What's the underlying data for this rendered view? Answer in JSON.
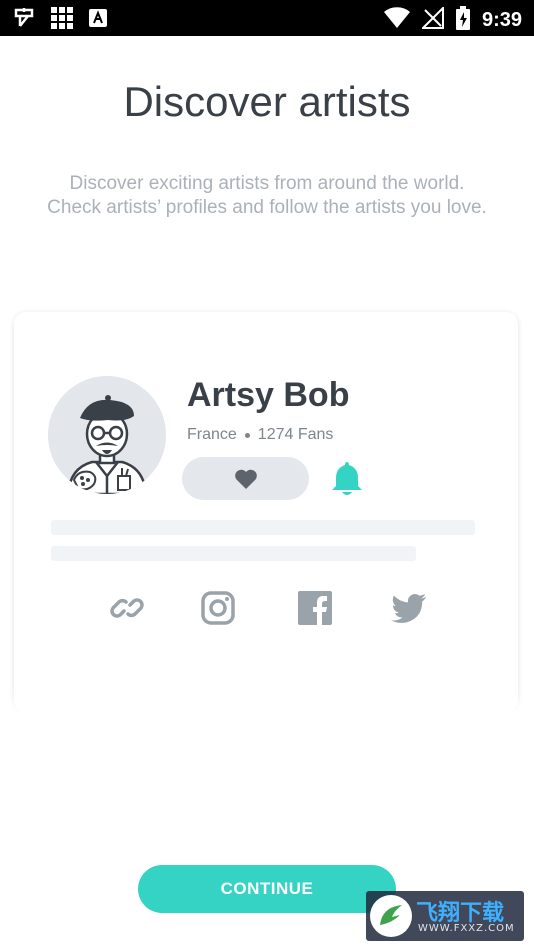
{
  "status_bar": {
    "time": "9:39",
    "left_icons": [
      "app-notification-icon",
      "grid-icon",
      "text-a-icon"
    ],
    "right_icons": [
      "wifi-icon",
      "no-signal-icon",
      "battery-charging-icon"
    ]
  },
  "header": {
    "title": "Discover artists",
    "subtitle": "Discover exciting artists from around the world. Check artists’ profiles and follow the artists you love."
  },
  "artist_card": {
    "name": "Artsy Bob",
    "country": "France",
    "fans": "1274 Fans",
    "like_icon": "heart-icon",
    "notify_icon": "bell-icon",
    "social_icons": [
      "link-icon",
      "instagram-icon",
      "facebook-icon",
      "twitter-icon"
    ]
  },
  "actions": {
    "continue_label": "CONTINUE"
  },
  "watermark": {
    "text": "飞翔下载",
    "url": "WWW.FXXZ.COM"
  },
  "colors": {
    "accent": "#35d3c4",
    "title": "#3a4048",
    "subtitle": "#aab1b8",
    "icon_gray": "#9aa2aa"
  }
}
